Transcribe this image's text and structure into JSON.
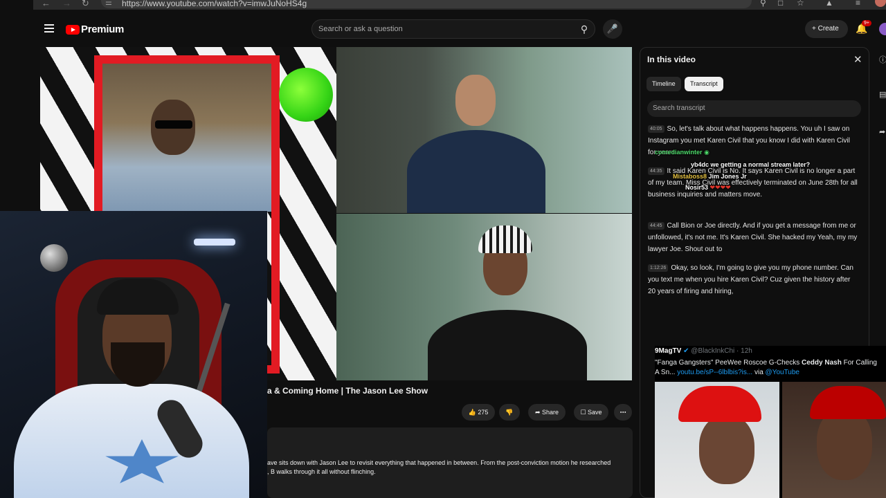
{
  "browser": {
    "url": "https://www.youtube.com/watch?v=imwJuNoHS4g",
    "back_icon": "arrow-left-icon",
    "forward_icon": "arrow-right-icon",
    "reload_icon": "reload-icon"
  },
  "header": {
    "brand": "Premium",
    "search_placeholder": "Search or ask a question",
    "create_label": "Create",
    "notification_count": "9+"
  },
  "video": {
    "title_visible": "a & Coming Home | The Jason Lee Show",
    "like_count": "275",
    "share_label": "Share",
    "save_label": "Save",
    "description_line1": "ave sits down with Jason Lee to revisit everything that happened in between. From the post-conviction motion he researched",
    "description_line2": ", B walks through it all without flinching."
  },
  "panel": {
    "title": "In this video",
    "tabs": [
      "Timeline",
      "Transcript"
    ],
    "search_placeholder": "Search transcript",
    "segments": [
      {
        "time": "40:05",
        "text": "So, let's talk about what happens happens. You uh I saw on Instagram you met Karen Civil that you know I did with Karen Civil for years."
      },
      {
        "time": "44:35",
        "text": "It said Karen Civil is No. It says Karen Civil is no longer a part of my team. Miss Civil was effectively terminated on June 28th for all business inquiries and matters move."
      },
      {
        "time": "44:45",
        "text": "Call Bion or Joe directly. And if you get a message from me or unfollowed, it's not me. It's Karen Civil. She hacked my Yeah, my my lawyer Joe. Shout out to"
      },
      {
        "time": "1:12:26",
        "text": "Okay, so look, I'm going to give you my phone number. Can you text me when you hire Karen Civil? Cuz given the history after 20 years of firing and hiring,"
      }
    ]
  },
  "chat": [
    {
      "user": "comedianwinter",
      "message": "",
      "color": "#4dd86a"
    },
    {
      "user": "yb4dc",
      "message": "we getting a normal stream later?",
      "color": "#ffffff"
    },
    {
      "user": "Mistaboss8",
      "message": "Jim Jones Jr",
      "color": "#e7c342"
    },
    {
      "user": "Nosir53",
      "message": "",
      "color": "#ffffff"
    }
  ],
  "tweet": {
    "account": "9MagTV",
    "handle": "@BlackInkChi · 12h",
    "text_start": "\"Fanga Gangsters\" PeeWee Roscoe G-Checks ",
    "text_bold": "Ceddy Nash",
    "text_end": " For Calling",
    "text_line2_start": "A Sn... ",
    "link": "youtu.be/sP--6lblbis?is...",
    "via": " via ",
    "via_account": "@YouTube"
  },
  "colors": {
    "background": "#0f0f0f",
    "brand_red": "#ff0000",
    "link_blue": "#1d9bf0"
  }
}
